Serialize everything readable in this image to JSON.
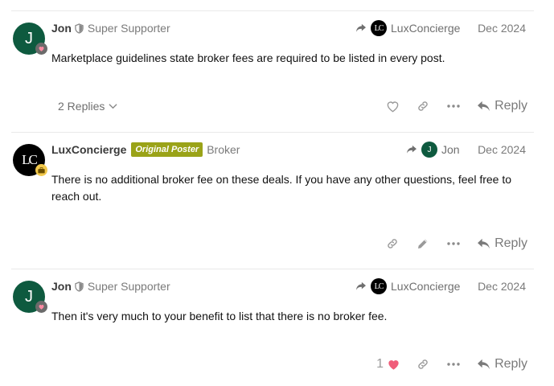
{
  "posts": [
    {
      "author": "Jon",
      "avatar_letter": "J",
      "user_title": "Super Supporter",
      "reply_to_name": "LuxConcierge",
      "reply_to_avatar": "LC",
      "date": "Dec 2024",
      "body": "Marketplace guidelines state broker fees are required to be listed in every post.",
      "replies_label": "2 Replies"
    },
    {
      "author": "LuxConcierge",
      "avatar_letter": "LC",
      "flair": "Original Poster",
      "user_title": "Broker",
      "reply_to_name": "Jon",
      "reply_to_avatar": "J",
      "date": "Dec 2024",
      "body": "There is no additional broker fee on these deals. If you have any other questions, feel free to reach out."
    },
    {
      "author": "Jon",
      "avatar_letter": "J",
      "user_title": "Super Supporter",
      "reply_to_name": "LuxConcierge",
      "reply_to_avatar": "LC",
      "date": "Dec 2024",
      "body": "Then it's very much to your benefit to list that there is no broker fee.",
      "like_count": "1"
    }
  ],
  "reply_label": "Reply",
  "colors": {
    "jon_avatar": "#0e5a3f",
    "op_flair": "#9aa318",
    "liked_heart": "#f05d7a"
  },
  "icons": [
    "heart-icon",
    "link-icon",
    "more-icon",
    "reply-arrow-icon",
    "pencil-icon",
    "shield-icon",
    "chevron-down-icon",
    "share-arrow-icon",
    "briefcase-icon"
  ]
}
